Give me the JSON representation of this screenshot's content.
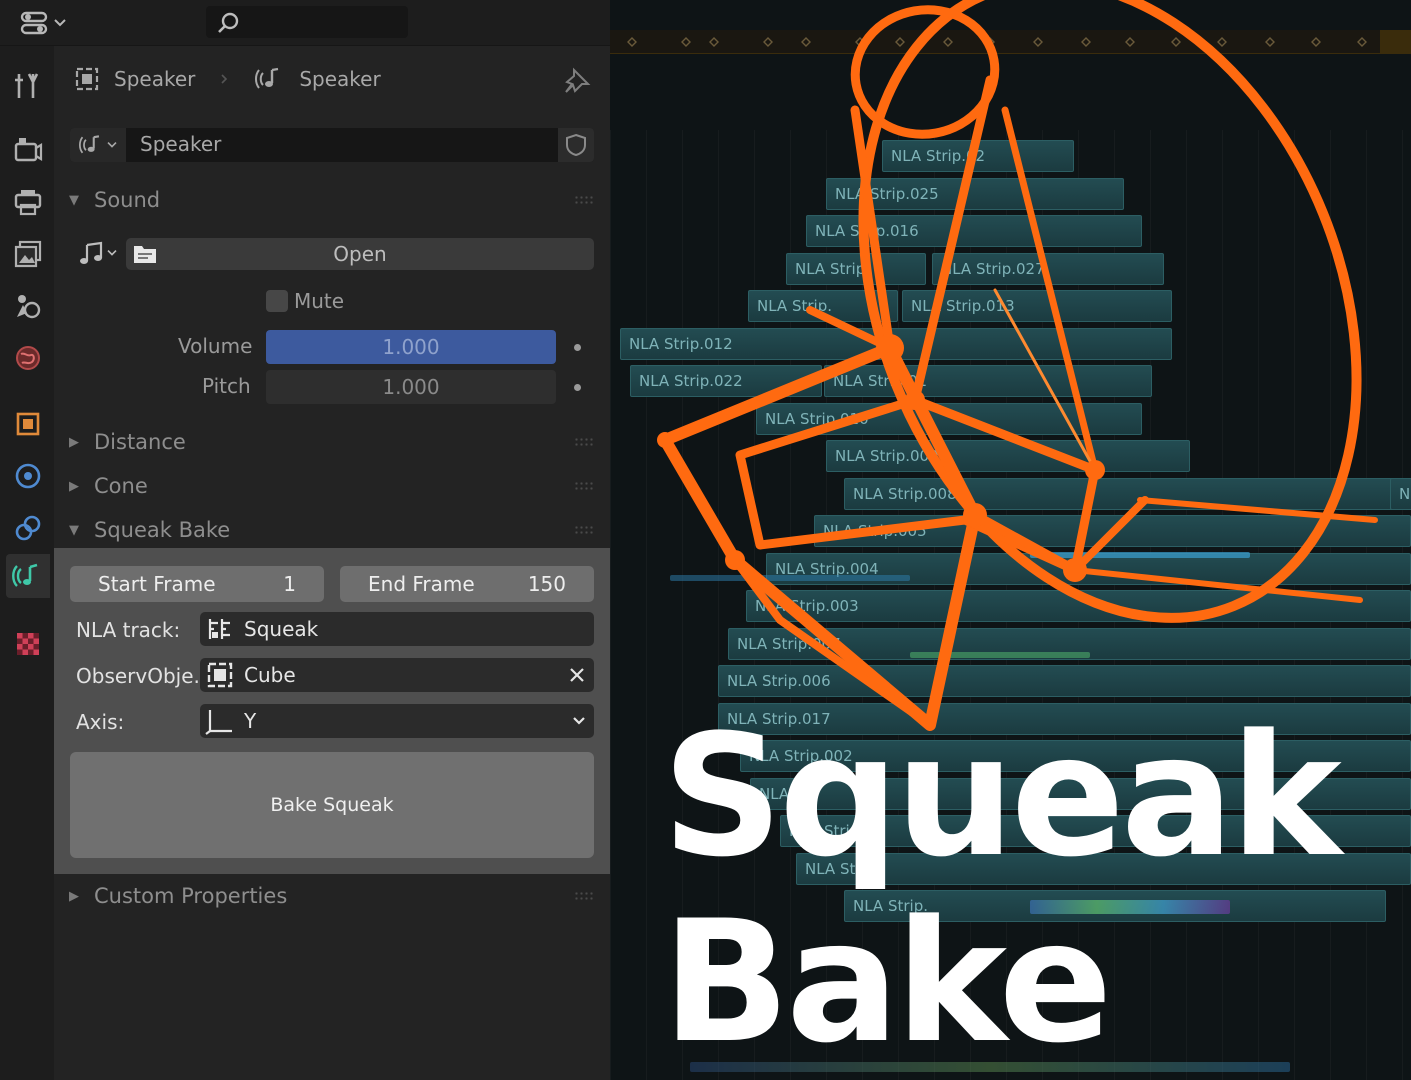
{
  "header": {
    "editor_type_icon": "properties-editor-icon",
    "search_placeholder": ""
  },
  "sidebar_tabs": [
    {
      "name": "tool-tab",
      "icon": "tool-icon"
    },
    {
      "name": "render-tab",
      "icon": "render-icon"
    },
    {
      "name": "output-tab",
      "icon": "output-icon"
    },
    {
      "name": "view-layer-tab",
      "icon": "view-layer-icon"
    },
    {
      "name": "scene-tab",
      "icon": "scene-icon"
    },
    {
      "name": "world-tab",
      "icon": "world-icon"
    },
    {
      "name": "object-tab",
      "icon": "object-icon"
    },
    {
      "name": "physics-tab",
      "icon": "physics-icon"
    },
    {
      "name": "constraints-tab",
      "icon": "constraints-icon"
    },
    {
      "name": "speaker-data-tab",
      "icon": "speaker-icon",
      "active": true
    },
    {
      "name": "texture-tab",
      "icon": "texture-icon"
    }
  ],
  "breadcrumb": {
    "object_name": "Speaker",
    "data_name": "Speaker"
  },
  "datablock": {
    "name": "Speaker"
  },
  "sound_panel": {
    "title": "Sound",
    "open_label": "Open",
    "mute_label": "Mute",
    "volume_label": "Volume",
    "volume_value": "1.000",
    "pitch_label": "Pitch",
    "pitch_value": "1.000"
  },
  "collapsed_panels": {
    "distance": "Distance",
    "cone": "Cone"
  },
  "squeak_bake_panel": {
    "title": "Squeak Bake",
    "start_frame_label": "Start Frame",
    "start_frame_value": "1",
    "end_frame_label": "End Frame",
    "end_frame_value": "150",
    "nla_track_label": "NLA track:",
    "nla_track_value": "Squeak",
    "observer_label": "ObservObje...",
    "observer_value": "Cube",
    "axis_label": "Axis:",
    "axis_value": "Y",
    "bake_button_label": "Bake Squeak"
  },
  "custom_properties": {
    "title": "Custom Properties"
  },
  "nla_strips": [
    "NLA Strip.02",
    "NLA Strip.025",
    "NLA Strip.016",
    "NLA Strip.",
    "NLA Strip.027",
    "NLA Strip.",
    "NLA Strip.013",
    "NLA Strip.012",
    "NLA Strip.022",
    "NLA Strip.01",
    "NLA Strip.010",
    "NLA Strip.009",
    "NLA Strip.008",
    "NLA Strip.005",
    "NLA Strip.004",
    "NLA Strip.003",
    "NLA Strip.007",
    "NLA Strip.006",
    "NLA Strip.017",
    "NLA Strip.002",
    "NLA St",
    "NLA Strip.02",
    "NLA Strip.",
    "NLA Strip."
  ],
  "title": {
    "line1": "Squeak",
    "line2": "Bake"
  },
  "colors": {
    "accent_blue": "#3d5a9e",
    "logo_orange": "#ff6a10",
    "nla_strip": "#234c52"
  }
}
